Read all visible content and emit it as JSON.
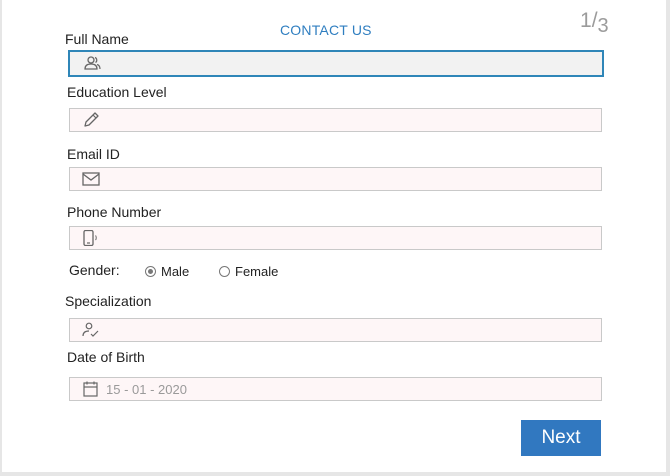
{
  "header": {
    "title": "CONTACT US",
    "step_current": "1",
    "step_separator": "/",
    "step_total": "3"
  },
  "form": {
    "full_name": {
      "label": "Full Name",
      "value": "",
      "icon": "users-icon"
    },
    "education": {
      "label": "Education Level",
      "value": "",
      "icon": "pencil-icon"
    },
    "email": {
      "label": "Email ID",
      "value": "",
      "icon": "mail-icon"
    },
    "phone": {
      "label": "Phone Number",
      "value": "",
      "icon": "phone-icon"
    },
    "gender": {
      "label": "Gender:",
      "options": [
        "Male",
        "Female"
      ],
      "selected": "Male"
    },
    "specialization": {
      "label": "Specialization",
      "value": "",
      "icon": "user-check-icon"
    },
    "dob": {
      "label": "Date of Birth",
      "value": "15 - 01 - 2020",
      "icon": "calendar-icon"
    }
  },
  "actions": {
    "next_label": "Next"
  },
  "colors": {
    "accent": "#3178c0",
    "focus_border": "#2f86b8",
    "field_bg": "#fef6f7"
  }
}
